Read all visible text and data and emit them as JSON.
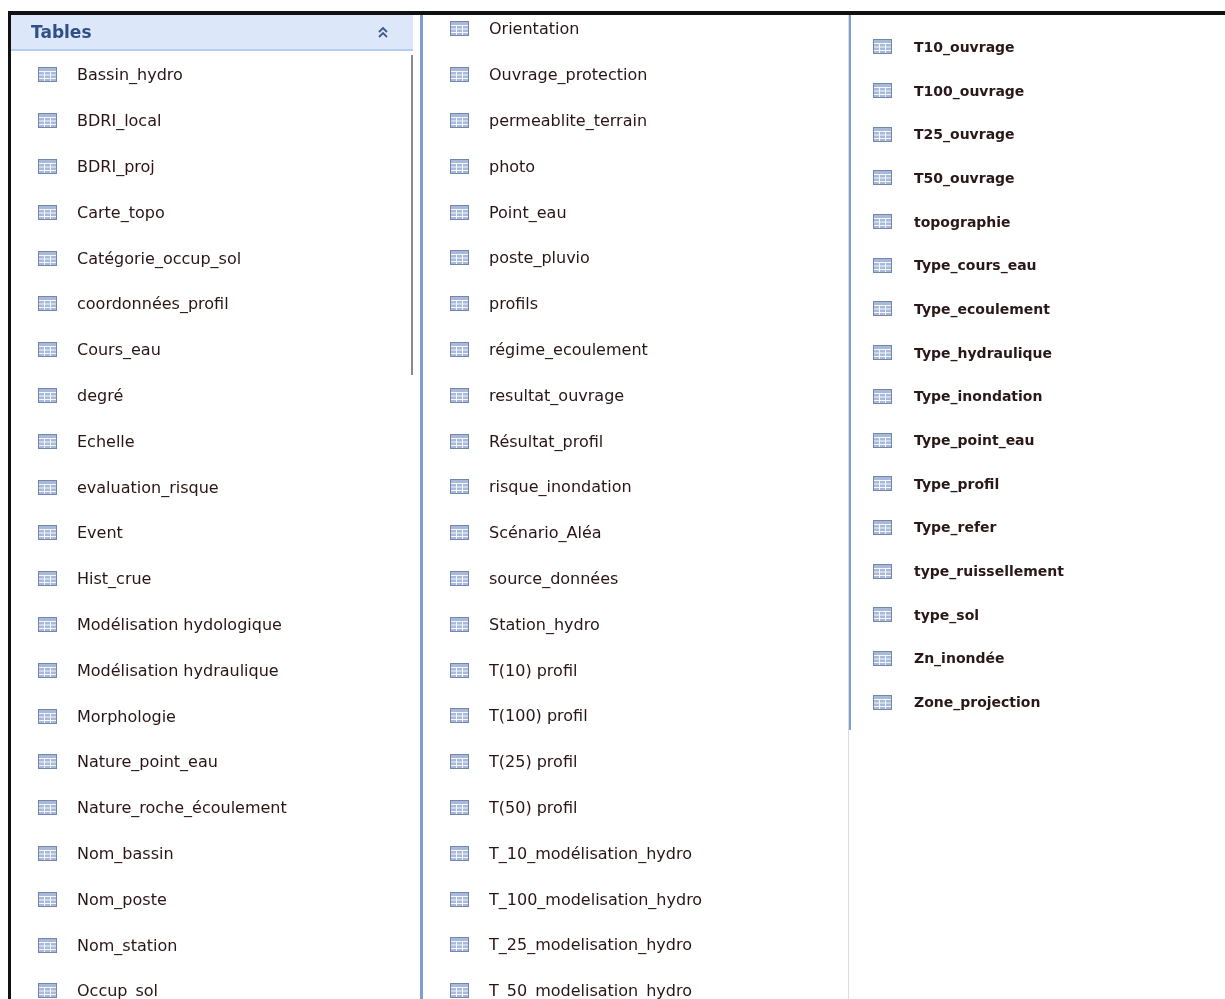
{
  "panel": {
    "title": "Tables"
  },
  "columns": [
    {
      "items": [
        "Bassin_hydro",
        "BDRI_local",
        "BDRI_proj",
        "Carte_topo",
        "Catégorie_occup_sol",
        "coordonnées_profil",
        "Cours_eau",
        "degré",
        "Echelle",
        "evaluation_risque",
        "Event",
        "Hist_crue",
        "Modélisation hydologique",
        "Modélisation hydraulique",
        "Morphologie",
        "Nature_point_eau",
        "Nature_roche_écoulement",
        "Nom_bassin",
        "Nom_poste",
        "Nom_station",
        "Occup_sol"
      ]
    },
    {
      "items": [
        "Orientation",
        "Ouvrage_protection",
        "permeablite_terrain",
        "photo",
        "Point_eau",
        "poste_pluvio",
        "profils",
        "régime_ecoulement",
        "resultat_ouvrage",
        "Résultat_profil",
        "risque_inondation",
        "Scénario_Aléa",
        "source_données",
        "Station_hydro",
        "T(10) profil",
        "T(100) profil",
        "T(25) profil",
        "T(50) profil",
        "T_10_modélisation_hydro",
        "T_100_modelisation_hydro",
        "T_25_modelisation_hydro",
        "T_50_modelisation_hydro"
      ]
    },
    {
      "items": [
        "T10_ouvrage",
        "T100_ouvrage",
        "T25_ouvrage",
        "T50_ouvrage",
        "topographie",
        "Type_cours_eau",
        "Type_ecoulement",
        "Type_hydraulique",
        "Type_inondation",
        "Type_point_eau",
        "Type_profil",
        "Type_refer",
        "type_ruissellement",
        "type_sol",
        "Zn_inondée",
        "Zone_projection"
      ]
    }
  ]
}
